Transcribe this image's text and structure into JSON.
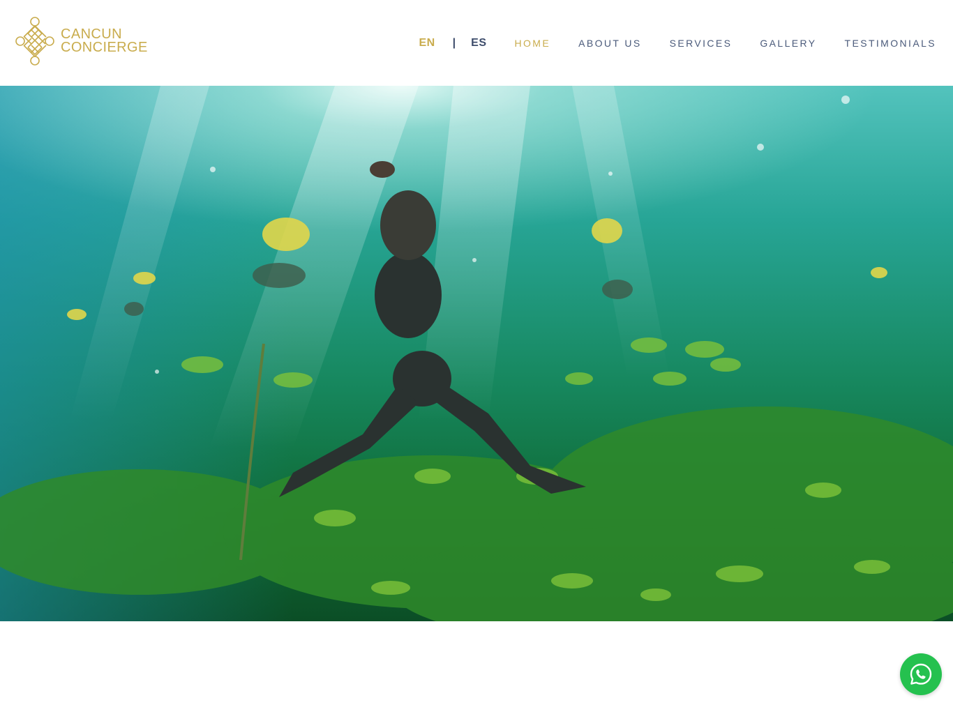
{
  "brand": {
    "name_line1": "CANCUN",
    "name_line2": "CONCIERGE",
    "logo_icon": "endless-knot-icon",
    "color": "#c9ac4d"
  },
  "language": {
    "current": "EN",
    "separator": "|",
    "other": "ES"
  },
  "nav": {
    "items": [
      {
        "label": "HOME",
        "active": true
      },
      {
        "label": "ABOUT US",
        "active": false
      },
      {
        "label": "SERVICES",
        "active": false
      },
      {
        "label": "GALLERY",
        "active": false
      },
      {
        "label": "TESTIMONIALS",
        "active": false
      }
    ],
    "active_color": "#c9ac4d",
    "text_color": "#4a5a7a"
  },
  "hero": {
    "media_type": "video",
    "icon": "hero-underwater-image"
  },
  "floating": {
    "whatsapp_icon": "whatsapp-icon",
    "color": "#25c14f"
  }
}
